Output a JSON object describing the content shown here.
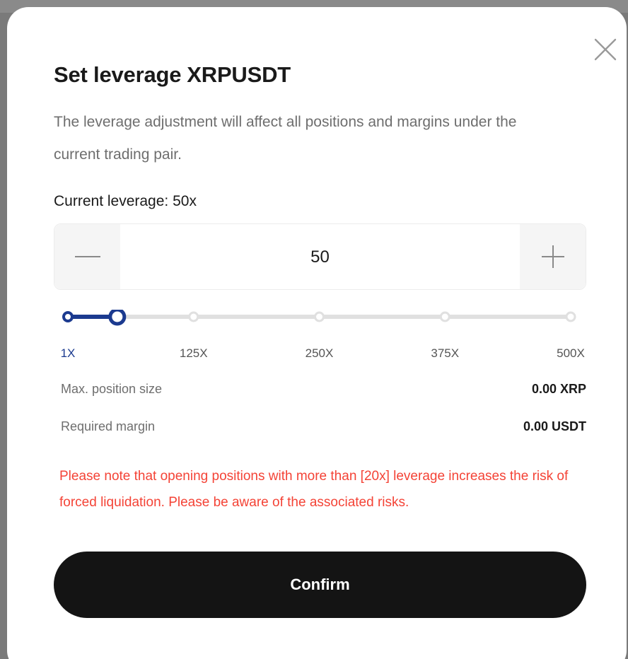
{
  "dialog": {
    "title": "Set leverage",
    "pair": "XRPUSDT",
    "description": "The leverage adjustment will affect all positions and margins under the current trading pair.",
    "current_leverage_label": "Current leverage: 50x"
  },
  "stepper": {
    "value": "50",
    "minus_icon": "minus-icon",
    "plus_icon": "plus-icon"
  },
  "slider": {
    "min": 1,
    "max": 500,
    "value": 50,
    "ticks": [
      "1X",
      "125X",
      "250X",
      "375X",
      "500X"
    ],
    "accent_color": "#1b3a8f",
    "track_color": "#e0e0e0"
  },
  "info": {
    "max_position_label": "Max. position size",
    "max_position_value": "0.00 XRP",
    "required_margin_label": "Required margin",
    "required_margin_value": "0.00 USDT"
  },
  "warning": "Please note that opening positions with more than [20x] leverage increases the risk of forced liquidation. Please be aware of the associated risks.",
  "confirm_label": "Confirm",
  "colors": {
    "warning": "#f44336",
    "confirm_bg": "#141414"
  }
}
